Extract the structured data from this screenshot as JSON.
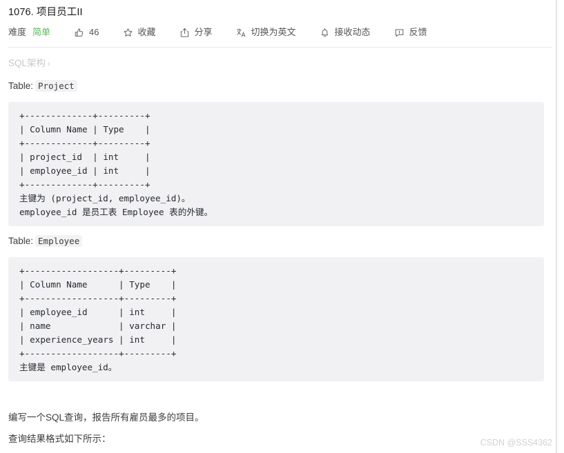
{
  "header": {
    "title": "1076. 项目员工II",
    "toolbar": [
      {
        "name": "difficulty",
        "icon": "",
        "label": "难度",
        "value": "简单",
        "value_color": "#5cb85c"
      },
      {
        "name": "like",
        "icon": "thumbs-up-icon",
        "label": "46"
      },
      {
        "name": "favorite",
        "icon": "star-icon",
        "label": "收藏"
      },
      {
        "name": "share",
        "icon": "share-icon",
        "label": "分享"
      },
      {
        "name": "translate",
        "icon": "translate-icon",
        "label": "切换为英文"
      },
      {
        "name": "subscribe",
        "icon": "bell-icon",
        "label": "接收动态"
      },
      {
        "name": "feedback",
        "icon": "feedback-icon",
        "label": "反馈"
      }
    ]
  },
  "content": {
    "schema_link": "SQL架构",
    "schema_chevron": "›",
    "table1": {
      "label": "Table:",
      "name": "Project",
      "code": "+-------------+---------+\n| Column Name | Type    |\n+-------------+---------+\n| project_id  | int     |\n| employee_id | int     |\n+-------------+---------+\n主键为 (project_id, employee_id)。\nemployee_id 是员工表 Employee 表的外键。"
    },
    "table2": {
      "label": "Table:",
      "name": "Employee",
      "code": "+------------------+---------+\n| Column Name      | Type    |\n+------------------+---------+\n| employee_id      | int     |\n| name             | varchar |\n| experience_years | int     |\n+------------------+---------+\n主键是 employee_id。"
    },
    "paragraph1": "编写一个SQL查询，报告所有雇员最多的项目。",
    "paragraph2": "查询结果格式如下所示："
  },
  "watermark": "CSDN @SSS4362",
  "colors": {
    "easy_green": "#5cb85c",
    "code_bg": "#f1f1f4",
    "text": "#3c3c3c",
    "muted": "#c8c8cc"
  }
}
